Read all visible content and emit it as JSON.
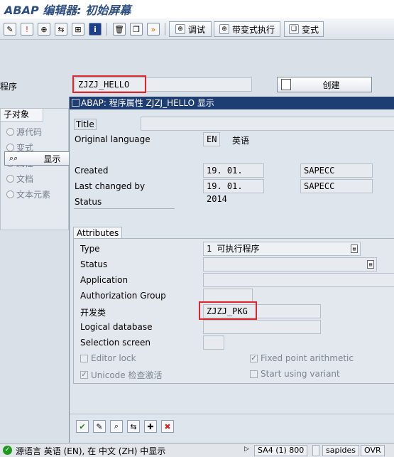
{
  "title": "ABAP 编辑器: 初始屏幕",
  "toolbar": {
    "debug_label": "调试",
    "run_variant_label": "带变式执行",
    "variant_label": "变式"
  },
  "program": {
    "label": "程序",
    "value": "ZJZJ_HELLO",
    "create_label": "创建"
  },
  "subobjects": {
    "header": "子对象",
    "items": [
      {
        "label": "源代码",
        "selected": false
      },
      {
        "label": "变式",
        "selected": false
      },
      {
        "label": "属性",
        "selected": true
      },
      {
        "label": "文档",
        "selected": false
      },
      {
        "label": "文本元素",
        "selected": false
      }
    ],
    "display_label": "显示"
  },
  "dialog": {
    "title": "ABAP: 程序属性 ZJZJ_HELLO 显示",
    "title_label": "Title",
    "original_language_label": "Original language",
    "original_language_code": "EN",
    "original_language_name": "英语",
    "created_label": "Created",
    "created_date": "19. 01. 2014",
    "created_user": "SAPECC",
    "last_changed_label": "Last changed by",
    "last_changed_date": "19. 01. 2014",
    "last_changed_user": "SAPECC",
    "status_label": "Status",
    "attributes": {
      "header": "Attributes",
      "type_label": "Type",
      "type_value": "1 可执行程序",
      "status_label": "Status",
      "application_label": "Application",
      "auth_group_label": "Authorization Group",
      "package_label": "开发类",
      "package_value": "ZJZJ_PKG",
      "logical_db_label": "Logical database",
      "selection_screen_label": "Selection screen",
      "editor_lock_label": "Editor lock",
      "fixed_point_label": "Fixed point arithmetic",
      "unicode_label": "Unicode 检查激活",
      "start_variant_label": "Start using variant"
    }
  },
  "statusbar": {
    "message": "源语言 英语 (EN), 在 中文 (ZH) 中显示",
    "system": "SA4 (1) 800",
    "server": "sapides",
    "mode": "OVR"
  },
  "colors": {
    "accent_title": "#2c4e82",
    "dialog_titlebar": "#1e3d73",
    "highlight_red": "#e0262a",
    "status_ok_green": "#1f9a1f"
  }
}
